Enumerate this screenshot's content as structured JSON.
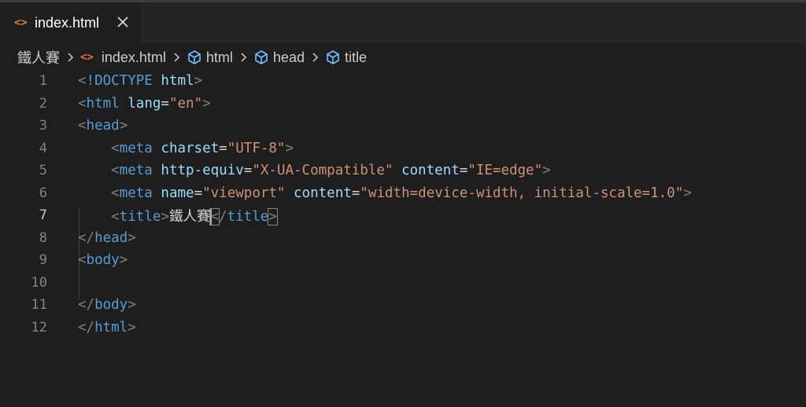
{
  "tab": {
    "icon_glyph": "<>",
    "label": "index.html",
    "icon_color": "#e37933"
  },
  "breadcrumb": {
    "items": [
      {
        "label": "鐵人賽",
        "icon": "folder"
      },
      {
        "label": "index.html",
        "icon": "html-file-icon",
        "icon_glyph": "<>"
      },
      {
        "label": "html",
        "icon": "symbol-cube-icon"
      },
      {
        "label": "head",
        "icon": "symbol-cube-icon"
      },
      {
        "label": "title",
        "icon": "symbol-cube-icon"
      }
    ]
  },
  "editor": {
    "active_line": 7,
    "lines": [
      {
        "number": "1",
        "tokens": [
          [
            "punct",
            "<"
          ],
          [
            "tag",
            "!DOCTYPE"
          ],
          [
            "eq",
            " "
          ],
          [
            "attr",
            "html"
          ],
          [
            "punct",
            ">"
          ]
        ]
      },
      {
        "number": "2",
        "tokens": [
          [
            "punct",
            "<"
          ],
          [
            "tag",
            "html"
          ],
          [
            "eq",
            " "
          ],
          [
            "attr",
            "lang"
          ],
          [
            "eq",
            "="
          ],
          [
            "str",
            "\"en\""
          ],
          [
            "punct",
            ">"
          ]
        ]
      },
      {
        "number": "3",
        "tokens": [
          [
            "punct",
            "<"
          ],
          [
            "tag",
            "head"
          ],
          [
            "punct",
            ">"
          ]
        ]
      },
      {
        "number": "4",
        "tokens": [
          [
            "eq",
            "    "
          ],
          [
            "punct",
            "<"
          ],
          [
            "tag",
            "meta"
          ],
          [
            "eq",
            " "
          ],
          [
            "attr",
            "charset"
          ],
          [
            "eq",
            "="
          ],
          [
            "str",
            "\"UTF-8\""
          ],
          [
            "punct",
            ">"
          ]
        ]
      },
      {
        "number": "5",
        "tokens": [
          [
            "eq",
            "    "
          ],
          [
            "punct",
            "<"
          ],
          [
            "tag",
            "meta"
          ],
          [
            "eq",
            " "
          ],
          [
            "attr",
            "http-equiv"
          ],
          [
            "eq",
            "="
          ],
          [
            "str",
            "\"X-UA-Compatible\""
          ],
          [
            "eq",
            " "
          ],
          [
            "attr",
            "content"
          ],
          [
            "eq",
            "="
          ],
          [
            "str",
            "\"IE=edge\""
          ],
          [
            "punct",
            ">"
          ]
        ]
      },
      {
        "number": "6",
        "tokens": [
          [
            "eq",
            "    "
          ],
          [
            "punct",
            "<"
          ],
          [
            "tag",
            "meta"
          ],
          [
            "eq",
            " "
          ],
          [
            "attr",
            "name"
          ],
          [
            "eq",
            "="
          ],
          [
            "str",
            "\"viewport\""
          ],
          [
            "eq",
            " "
          ],
          [
            "attr",
            "content"
          ],
          [
            "eq",
            "="
          ],
          [
            "str",
            "\"width=device-width, initial-scale=1.0\""
          ],
          [
            "punct",
            ">"
          ]
        ]
      },
      {
        "number": "7",
        "tokens": [
          [
            "eq",
            "    "
          ],
          [
            "punct",
            "<"
          ],
          [
            "tag",
            "title"
          ],
          [
            "punct",
            ">"
          ],
          [
            "text",
            "鐵人賽"
          ],
          [
            "cursor",
            ""
          ],
          [
            "matchpunct",
            "<"
          ],
          [
            "punct",
            "/"
          ],
          [
            "tag",
            "title"
          ],
          [
            "matchpunct",
            ">"
          ]
        ]
      },
      {
        "number": "8",
        "tokens": [
          [
            "punct",
            "</"
          ],
          [
            "tag",
            "head"
          ],
          [
            "punct",
            ">"
          ]
        ]
      },
      {
        "number": "9",
        "tokens": [
          [
            "punct",
            "<"
          ],
          [
            "tag",
            "body"
          ],
          [
            "punct",
            ">"
          ]
        ]
      },
      {
        "number": "10",
        "tokens": []
      },
      {
        "number": "11",
        "tokens": [
          [
            "punct",
            "</"
          ],
          [
            "tag",
            "body"
          ],
          [
            "punct",
            ">"
          ]
        ]
      },
      {
        "number": "12",
        "tokens": [
          [
            "punct",
            "</"
          ],
          [
            "tag",
            "html"
          ],
          [
            "punct",
            ">"
          ]
        ]
      }
    ]
  },
  "colors": {
    "background": "#1e1e1e",
    "tag": "#569cd6",
    "attribute": "#9cdcfe",
    "string": "#ce9178",
    "punctuation": "#808080",
    "line_number": "#858585"
  }
}
